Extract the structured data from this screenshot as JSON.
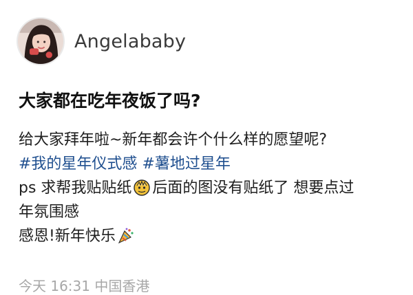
{
  "user": {
    "name": "Angelababy",
    "avatar_icon": "avatar-photo"
  },
  "post": {
    "title": "大家都在吃年夜饭了吗?",
    "line1": "给大家拜年啦~新年都会许个什么样的愿望呢?",
    "hashtag1": "#我的星年仪式感",
    "hashtag2": "#薯地过星年",
    "line3_prefix": "ps 求帮我贴贴纸",
    "line3_suffix": "后面的图没有贴纸了 想要点过",
    "line4": "年氛围感",
    "line5": "感恩!新年快乐",
    "emoji1": "dragon-emoji",
    "emoji2": "party-popper-emoji"
  },
  "meta": {
    "text": "今天 16:31 中国香港"
  },
  "colors": {
    "hashtag": "#1f4f8f",
    "meta": "#a7a7a7"
  }
}
